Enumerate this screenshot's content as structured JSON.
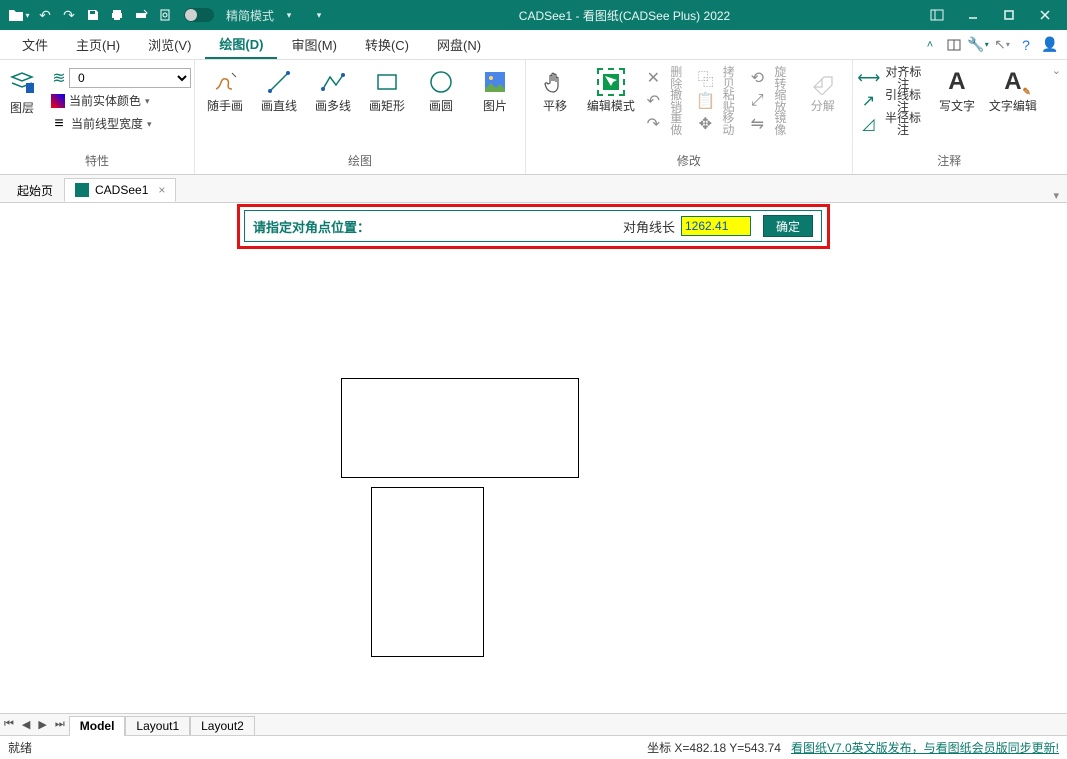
{
  "titlebar": {
    "mode_label": "精简模式",
    "app_title": "CADSee1 - 看图纸(CADSee Plus) 2022"
  },
  "menu": {
    "items": [
      {
        "label": "文件"
      },
      {
        "label": "主页(H)"
      },
      {
        "label": "浏览(V)"
      },
      {
        "label": "绘图(D)",
        "active": true
      },
      {
        "label": "审图(M)"
      },
      {
        "label": "转换(C)"
      },
      {
        "label": "网盘(N)"
      }
    ]
  },
  "ribbon": {
    "layer_label": "图层",
    "layer_value": "0",
    "prop_color_label": "当前实体颜色",
    "prop_linewidth_label": "当前线型宽度",
    "group_props": "特性",
    "draw": {
      "freehand": "随手画",
      "line": "画直线",
      "polyline": "画多线",
      "rect": "画矩形",
      "circle": "画圆",
      "image": "图片"
    },
    "group_draw": "绘图",
    "modify": {
      "pan": "平移",
      "edit_mode": "编辑模式",
      "delete": "删除",
      "undo": "撤销",
      "redo": "重做",
      "copy": "拷贝",
      "paste": "粘贴",
      "move": "移动",
      "rotate": "旋转",
      "scale": "缩放",
      "mirror": "镜像",
      "explode": "分解"
    },
    "group_modify": "修改",
    "annot": {
      "align_dim": "对齐标注",
      "leader_dim": "引线标注",
      "radius_dim": "半径标注",
      "text": "写文字",
      "text_edit": "文字编辑"
    },
    "group_annot": "注释"
  },
  "tabs": {
    "start_tab": "起始页",
    "doc_tab": "CADSee1"
  },
  "prompt": {
    "text": "请指定对角点位置：",
    "field_label": "对角线长",
    "value": "1262.41",
    "ok": "确定"
  },
  "layout": {
    "model": "Model",
    "layout1": "Layout1",
    "layout2": "Layout2"
  },
  "status": {
    "ready": "就绪",
    "coords": "坐标 X=482.18 Y=543.74",
    "link": "看图纸V7.0英文版发布，与看图纸会员版同步更新!"
  }
}
